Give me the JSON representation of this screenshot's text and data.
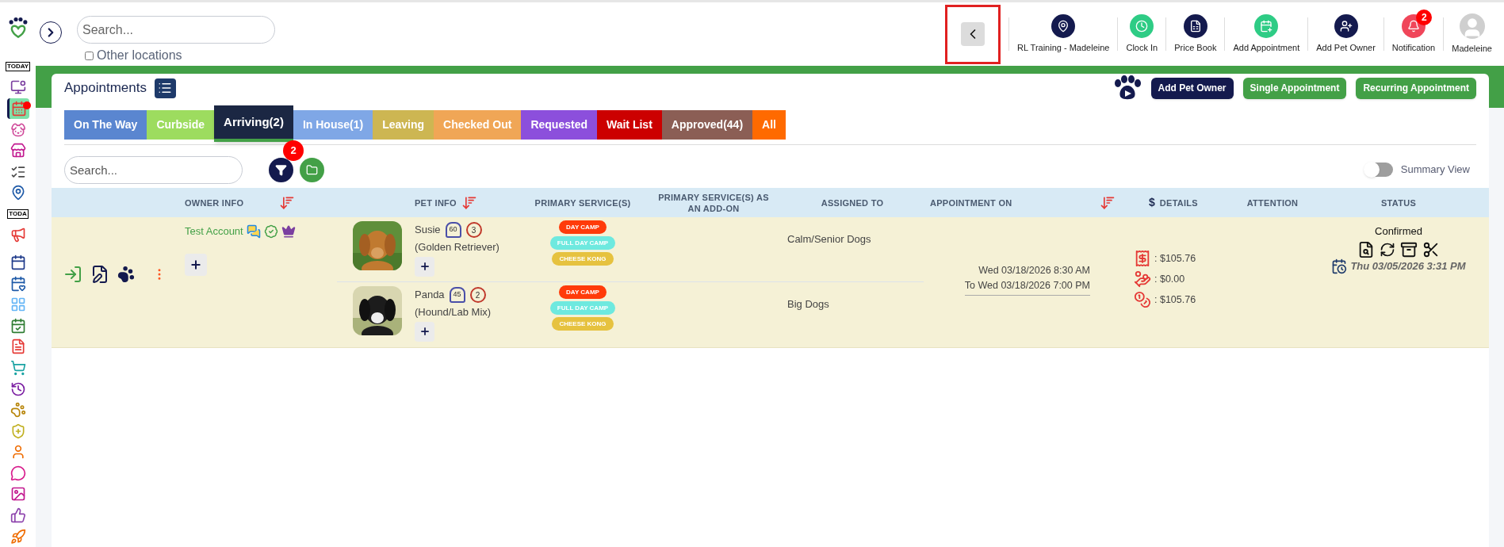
{
  "topbar": {
    "search": {
      "placeholder": "Search..."
    },
    "other_locations": {
      "label": "Other locations",
      "checked": false
    },
    "nav": [
      {
        "kind": "location",
        "label": "RL Training - Madeleine"
      },
      {
        "kind": "clock",
        "label": "Clock In"
      },
      {
        "kind": "book",
        "label": "Price Book"
      },
      {
        "kind": "calendar",
        "label": "Add Appointment"
      },
      {
        "kind": "owner",
        "label": "Add Pet Owner"
      },
      {
        "kind": "bell",
        "label": "Notification",
        "badge": "2"
      },
      {
        "kind": "avatar",
        "label": "Madeleine"
      }
    ]
  },
  "sidebar": {
    "items": [
      {
        "label": "TODAY",
        "selected": false
      },
      {
        "selected": false
      },
      {
        "selected": true
      },
      {
        "selected": false
      },
      {
        "selected": false
      },
      {
        "selected": false
      },
      {
        "selected": false
      },
      {
        "label": "TODA",
        "selected": false
      },
      {
        "selected": false
      },
      {
        "selected": false
      },
      {
        "selected": false
      },
      {
        "selected": false
      },
      {
        "selected": false
      },
      {
        "selected": false
      },
      {
        "selected": false
      },
      {
        "selected": false
      },
      {
        "selected": false
      },
      {
        "selected": false
      },
      {
        "selected": false
      },
      {
        "selected": false
      },
      {
        "selected": false
      },
      {
        "selected": false
      },
      {
        "selected": false
      }
    ]
  },
  "page": {
    "title": "Appointments",
    "buttons": [
      {
        "label": "Add Pet Owner",
        "color": "#141a4e"
      },
      {
        "label": "Single Appointment",
        "color": "#43a047"
      },
      {
        "label": "Recurring Appointment",
        "color": "#43a047"
      }
    ]
  },
  "tabs": [
    {
      "label": "On The Way",
      "color": "#5a86d0",
      "selected": false
    },
    {
      "label": "Curbside",
      "color": "#9ddc5f",
      "selected": false
    },
    {
      "label": "Arriving(2)",
      "color": "#1b2743",
      "selected": true
    },
    {
      "label": "In House(1)",
      "color": "#7fa7e6",
      "selected": false
    },
    {
      "label": "Leaving",
      "color": "#cdb652",
      "selected": false
    },
    {
      "label": "Checked Out",
      "color": "#f0a656",
      "selected": false
    },
    {
      "label": "Requested",
      "color": "#8c4fdc",
      "selected": false
    },
    {
      "label": "Wait List",
      "color": "#cc0000",
      "selected": false
    },
    {
      "label": "Approved(44)",
      "color": "#8b5e55",
      "selected": false
    },
    {
      "label": "All",
      "color": "#ff6a00",
      "selected": false
    }
  ],
  "toolbar": {
    "search": {
      "placeholder": "Search..."
    },
    "filter_badge": "2",
    "summary_view": {
      "label": "Summary View",
      "on": false
    }
  },
  "table": {
    "columns": [
      {},
      {
        "label": "OWNER INFO",
        "sortable": true
      },
      {},
      {
        "label": "PET INFO",
        "sortable": true
      },
      {
        "label": "PRIMARY SERVICE(S)"
      },
      {
        "label": "PRIMARY SERVICE(S) AS AN ADD-ON"
      },
      {
        "label": "ASSIGNED TO"
      },
      {
        "label": "APPOINTMENT ON",
        "sortable": true
      },
      {
        "label": "DETAILS",
        "prefix": "$"
      },
      {
        "label": "ATTENTION"
      },
      {
        "label": "STATUS"
      }
    ],
    "rows": [
      {
        "owner": "Test Account",
        "pets": [
          {
            "name": "Susie",
            "weight": "60",
            "visits": "3",
            "breed": "(Golden Retriever)",
            "services": [
              {
                "label": "DAY CAMP",
                "color": "#ff3b0a"
              },
              {
                "label": "FULL DAY CAMP",
                "color": "#6ee9df"
              },
              {
                "label": "CHEESE KONG",
                "color": "#e6c23f"
              }
            ],
            "assigned": "Calm/Senior Dogs"
          },
          {
            "name": "Panda",
            "weight": "45",
            "visits": "2",
            "breed": "(Hound/Lab Mix)",
            "services": [
              {
                "label": "DAY CAMP",
                "color": "#ff3b0a"
              },
              {
                "label": "FULL DAY CAMP",
                "color": "#6ee9df"
              },
              {
                "label": "CHEESE KONG",
                "color": "#e6c23f"
              }
            ],
            "assigned": "Big Dogs"
          }
        ],
        "appointment": [
          "Wed 03/18/2026 8:30 AM",
          "To Wed 03/18/2026 7:00 PM"
        ],
        "details": [
          {
            "kind": "invoice",
            "value": ": $105.76"
          },
          {
            "kind": "deposit",
            "value": ": $0.00"
          },
          {
            "kind": "balance",
            "value": ": $105.76"
          }
        ],
        "status": "Confirmed",
        "status_date": "Thu 03/05/2026 3:31 PM"
      }
    ]
  }
}
